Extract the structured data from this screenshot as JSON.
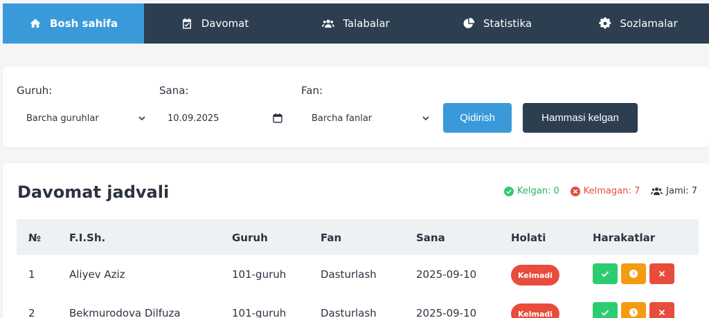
{
  "nav": {
    "items": [
      {
        "label": "Bosh sahifa",
        "icon": "home-icon",
        "active": true
      },
      {
        "label": "Davomat",
        "icon": "calendar-check-icon",
        "active": false
      },
      {
        "label": "Talabalar",
        "icon": "users-icon",
        "active": false
      },
      {
        "label": "Statistika",
        "icon": "pie-chart-icon",
        "active": false
      },
      {
        "label": "Sozlamalar",
        "icon": "gear-icon",
        "active": false
      }
    ]
  },
  "filters": {
    "group_label": "Guruh:",
    "group_value": "Barcha guruhlar",
    "date_label": "Sana:",
    "date_value": "10.09.2025",
    "subject_label": "Fan:",
    "subject_value": "Barcha fanlar",
    "search_button": "Qidirish",
    "all_present_button": "Hammasi kelgan"
  },
  "table": {
    "title": "Davomat jadvali",
    "stats": {
      "present": "Kelgan: 0",
      "absent": "Kelmagan: 7",
      "total": "Jami: 7"
    },
    "headers": [
      "№",
      "F.I.Sh.",
      "Guruh",
      "Fan",
      "Sana",
      "Holati",
      "Harakatlar"
    ],
    "rows": [
      {
        "num": "1",
        "name": "Aliyev Aziz",
        "group": "101-guruh",
        "subject": "Dasturlash",
        "date": "2025-09-10",
        "status": "Kelmadi"
      },
      {
        "num": "2",
        "name": "Bekmurodova Dilfuza",
        "group": "101-guruh",
        "subject": "Dasturlash",
        "date": "2025-09-10",
        "status": "Kelmadi"
      }
    ]
  },
  "colors": {
    "nav_bg": "#2c3e50",
    "accent": "#3a9ad9",
    "success": "#2ecc71",
    "warning": "#f39c12",
    "danger": "#e74c3c"
  }
}
